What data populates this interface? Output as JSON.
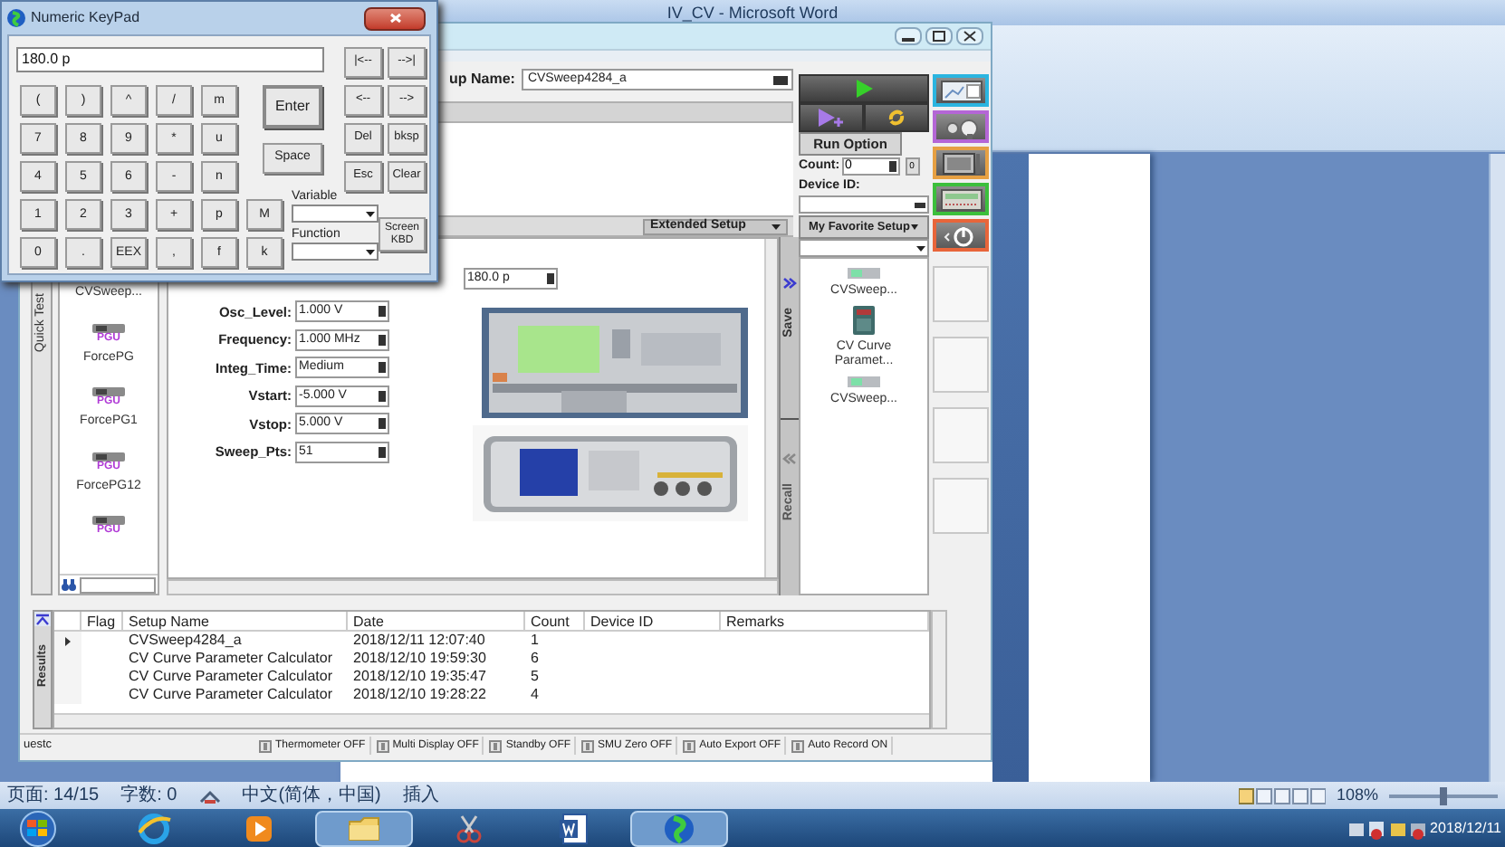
{
  "word_window": {
    "title": "IV_CV - Microsoft Word",
    "status_bar": [
      "页面: 14/15",
      "字数: 0",
      "中文(简体，中国)",
      "插入"
    ],
    "zoom": {
      "text": "108%",
      "level": 0.5
    }
  },
  "keypad": {
    "title": "Numeric KeyPad",
    "display": "180.0 p",
    "rows": [
      [
        "(",
        ")",
        "^",
        "/",
        "m"
      ],
      [
        "7",
        "8",
        "9",
        "*",
        "u"
      ],
      [
        "4",
        "5",
        "6",
        "-",
        "n"
      ],
      [
        "1",
        "2",
        "3",
        "+",
        "p",
        "M"
      ],
      [
        "0",
        ".",
        "EEX",
        ",",
        "f",
        "k"
      ]
    ],
    "enter": "Enter",
    "space": "Space",
    "nav": [
      [
        "|<--",
        "-->|"
      ],
      [
        "<--",
        "-->"
      ],
      [
        "Del",
        "bksp"
      ],
      [
        "Esc",
        "Clear"
      ]
    ],
    "variable_label": "Variable",
    "function_label": "Function",
    "screen_kbd": "Screen KBD"
  },
  "app_window": {
    "setup_name": {
      "label": "up Name:",
      "value": "CVSweep4284_a"
    },
    "extended_setup": "Extended Setup",
    "side_tab": "Quick Test",
    "library": [
      {
        "kind": "label_only",
        "label": "CVSweep..."
      },
      {
        "kind": "pgu",
        "badge": "PGU",
        "label": "ForcePG"
      },
      {
        "kind": "pgu",
        "badge": "PGU",
        "label": "ForcePG1"
      },
      {
        "kind": "pgu",
        "badge": "PGU",
        "label": "ForcePG12"
      },
      {
        "kind": "pgu",
        "badge": "PGU"
      }
    ],
    "extra_value": "180.0 p",
    "params": [
      {
        "label": "Osc_Level:",
        "value": "1.000 V"
      },
      {
        "label": "Frequency:",
        "value": "1.000 MHz"
      },
      {
        "label": "Integ_Time:",
        "value": "Medium"
      },
      {
        "label": "Vstart:",
        "value": "-5.000 V"
      },
      {
        "label": "Vstop:",
        "value": "5.000 V"
      },
      {
        "label": "Sweep_Pts:",
        "value": "51"
      }
    ],
    "run_option": "Run Option",
    "count_label": "Count:",
    "count": "0",
    "count_reset": "0",
    "device_id_label": "Device ID:",
    "favorite_menu": "My Favorite Setup",
    "favorites": [
      {
        "kind": "meter",
        "label": "CVSweep..."
      },
      {
        "kind": "calculator",
        "label": "CV Curve Paramet..."
      },
      {
        "kind": "meter",
        "label": "CVSweep..."
      }
    ],
    "save": "Save",
    "recall": "Recall",
    "mode_buttons": [
      {
        "kind": "graph",
        "color": "#2bb5e0"
      },
      {
        "kind": "tools",
        "color": "#b466d6"
      },
      {
        "kind": "monitor",
        "color": "#e6a043"
      },
      {
        "kind": "instrument",
        "color": "#3cbf3c"
      },
      {
        "kind": "power",
        "color": "#e8653a"
      }
    ],
    "results": {
      "tab": "Results",
      "columns": [
        "Flag",
        "Setup Name",
        "Date",
        "Count",
        "Device ID",
        "Remarks"
      ],
      "rows": [
        {
          "current": true,
          "setup_name": "CVSweep4284_a",
          "date": "2018/12/11 12:07:40",
          "count": "1"
        },
        {
          "current": false,
          "setup_name": "CV Curve Parameter Calculator",
          "date": "2018/12/10 19:59:30",
          "count": "6"
        },
        {
          "current": false,
          "setup_name": "CV Curve Parameter Calculator",
          "date": "2018/12/10 19:35:47",
          "count": "5"
        },
        {
          "current": false,
          "setup_name": "CV Curve Parameter Calculator",
          "date": "2018/12/10 19:28:22",
          "count": "4"
        }
      ]
    },
    "status": {
      "user": "uestc",
      "toggles": [
        "Thermometer OFF",
        "Multi Display OFF",
        "Standby OFF",
        "SMU Zero OFF",
        "Auto Export OFF",
        "Auto Record ON"
      ]
    }
  },
  "taskbar": {
    "apps": [
      {
        "kind": "browser",
        "selected": false
      },
      {
        "kind": "player",
        "selected": false
      },
      {
        "kind": "folder",
        "selected": true
      },
      {
        "kind": "snip",
        "selected": false
      },
      {
        "kind": "word",
        "selected": false
      },
      {
        "kind": "globe",
        "selected": true
      }
    ],
    "date": "2018/12/11"
  }
}
